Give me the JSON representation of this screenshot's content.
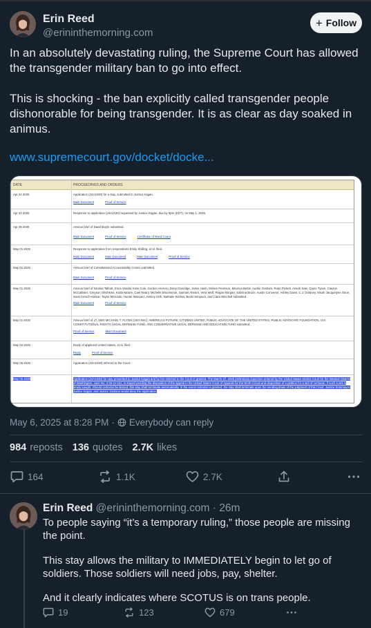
{
  "main_post": {
    "author_name": "Erin Reed",
    "author_handle": "@erininthemorning.com",
    "follow_label": "Follow",
    "paragraphs": [
      "In an absolutely devastating ruling, the Supreme Court has allowed the transgender military ban to go into effect.",
      "This is shocking - the ban explicitly called transgender people dishonorable for being transgender. It is as clear as day soaked in animus."
    ],
    "link_text": "www.supremecourt.gov/docket/docke...",
    "timestamp": "May 6, 2025 at 8:28 PM",
    "reply_setting": "Everybody can reply",
    "stats": {
      "reposts_count": "984",
      "reposts_label": "reposts",
      "quotes_count": "136",
      "quotes_label": "quotes",
      "likes_count": "2.7K",
      "likes_label": "likes"
    },
    "actions": {
      "replies": "164",
      "reposts": "1.1K",
      "likes": "2.7K"
    }
  },
  "docket": {
    "header_date": "DATE",
    "header_proceedings": "PROCEEDINGS AND ORDERS",
    "rows": [
      {
        "date": "Apr 24 2025",
        "text": "Application (24A1030) for a stay, submitted to Justice Kagan.",
        "links": [
          "Main Document",
          "Proof of Service"
        ]
      },
      {
        "date": "Apr 24 2025",
        "text": "Response to application (24A1030) requested by Justice Kagan, due by 5pm (EDT), on May 1, 2025.",
        "links": []
      },
      {
        "date": "Apr 28 2025",
        "text": "Amicus brief of David Boyle submitted.",
        "links": [
          "Main Document",
          "Proof of Service",
          "Certificate of Word Count"
        ]
      },
      {
        "date": "May 01 2025",
        "text": "Response to application from respondents Emily Shilling, et al. filed.",
        "links": [
          "Main Document",
          "Main Document",
          "Main Document",
          "Proof of Service"
        ]
      },
      {
        "date": "May 01 2025",
        "text": "Amicus brief of Constitutional Accountability Center submitted.",
        "links": [
          "Main Document",
          "Proof of Service"
        ]
      },
      {
        "date": "May 01 2025",
        "text": "Amicus brief of Nicolas Talbott, Erica Vandal, Kate Cole, Gordon Herrero, Dany Danridge, Jamie Hash, Miriam Perelson, Minerva Bettis, Audrie Graham, Roan Pickett, Amiah Sale, Quinn Tyson, Clayton McCallister, Greyson Shishkina, Koda Nature, Cael Neary, Michelle Bloomsnoe, Samuel Ahearn, Vera Wolf, Regan Morgan, Sabrina Bruce, Austin Converse, Ashley Davis, C.J. Dulaney, Micah Jacquelyne Stroe, Sean Kersch-Hamar, Taylor Mercado, Hunter Marquez, Kelsey Orth, Nathalie Richter, Becki Simpson, and Clara Winchell submitted.",
        "links": [
          "Main Document",
          "Proof of Service"
        ]
      },
      {
        "date": "May 01 2025",
        "text": "Amicus brief of LT. GEN MICHAEL T. FLYNN (USA-Ret.), AMERICA'S FUTURE, CITIZENS UNITED, PUBLIC ADVOCATE OF THE UNITED STATES, PUBLIC ADVOCATE FOUNDATION, U.S. CONSTITUTIONAL RIGHTS LEGAL DEFENSE FUND, AND CONSERVATIVE LEGAL DEFENSE AND EDUCATION FUND submitted.",
        "links": [
          "Proof of Service",
          "Main Document"
        ]
      },
      {
        "date": "May 02 2025",
        "text": "Reply of applicant United States, et al. filed.",
        "links": [
          "Reply",
          "Proof of Service"
        ]
      },
      {
        "date": "May 06 2025",
        "text": "Application (24A1030) referred to the Court.",
        "links": []
      },
      {
        "date": "May 06 2025",
        "text": "Application (24A1030) for stay presented to Justice Kagan and by her referred to the Court is granted. The March 27, 2025 preliminary injunction entered by the United States District Court for the Western District of Washington, case No. 2:25-cv-241, is stayed pending the disposition of the appeal in the United States Court of Appeals for the Ninth Circuit and disposition of a petition for a writ of certiorari, if such a writ is timely sought. Should certiorari be denied, this stay shall terminate automatically. In the event certiorari is granted, the stay shall terminate upon the sending down of the judgment of this Court. Justice Sotomayor, Justice Kagan, and Justice Jackson would deny the application.",
        "links": []
      }
    ]
  },
  "reply_post": {
    "author_name": "Erin Reed",
    "author_handle": "@erininthemorning.com",
    "time": "· 26m",
    "paragraphs": [
      "To people saying “it’s a temporary ruling,” those people are missing the point.",
      "This stay allows the military to IMMEDIATELY begin to let go of soldiers. Those soldiers will need jobs, pay, shelter.",
      "And it clearly indicates where SCOTUS is on trans people."
    ],
    "actions": {
      "replies": "19",
      "reposts": "123",
      "likes": "679"
    }
  },
  "colors": {
    "background": "#15202b",
    "text": "#e7e9ea",
    "muted": "#8b98a5",
    "link": "#1d9bf0",
    "divider": "#38444d"
  }
}
